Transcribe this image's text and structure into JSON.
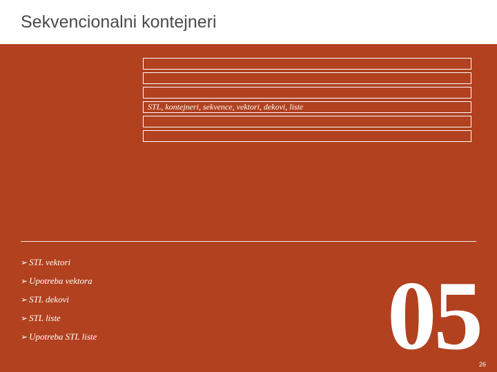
{
  "title": "Sekvencionalni kontejneri",
  "box_label": "STL, kontejneri, sekvence, vektori, dekovi, liste",
  "bullets": [
    "STL vektori",
    "Upotreba vektora",
    "STL dekovi",
    "STL liste",
    "Upotreba STL liste"
  ],
  "big_number": "05",
  "page_number": "26"
}
